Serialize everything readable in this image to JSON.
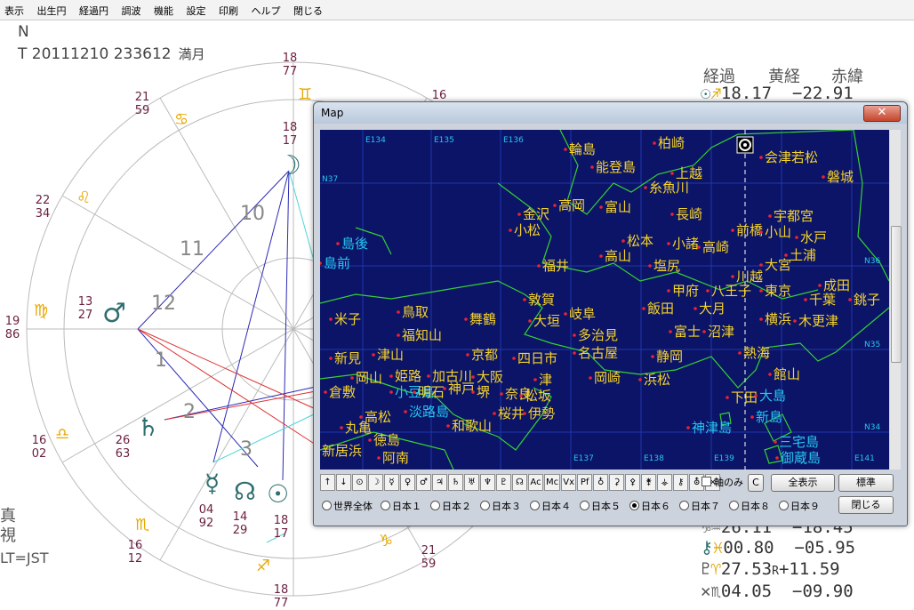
{
  "menu": [
    "表示",
    "出生円",
    "経過円",
    "調波",
    "機能",
    "設定",
    "印刷",
    "ヘルプ",
    "閉じる"
  ],
  "header": {
    "n": "N",
    "t": "T 20111210 233612",
    "moon": "満月"
  },
  "right_header": {
    "keika": "経過",
    "kokei": "黄経",
    "sekii": "赤緯"
  },
  "planets_top": {
    "value": "18.17",
    "dec": "−22.91"
  },
  "planets_bottom": [
    {
      "name": "chiron",
      "sign_icon": "pisces-icon",
      "value": "00.80",
      "dec": "−05.95"
    },
    {
      "name": "pluto",
      "sign_icon": "aries-icon",
      "value": "27.53",
      "retro": "R",
      "dec": "+11.59"
    },
    {
      "name": "node",
      "sign_icon": "scorpio-icon",
      "value": "04.05",
      "dec": "−09.90"
    }
  ],
  "partial_row": {
    "value": "26.11",
    "dec": "−18.45"
  },
  "bottom_left": {
    "shin": "真",
    "shi": "視",
    "lt": "LT=JST"
  },
  "chart_numbers": {
    "n18_77_top": "18",
    "n18_77_top_b": "77",
    "n21_59": "21",
    "n21_59_b": "59",
    "n22_34": "22",
    "n22_34_b": "34",
    "n13_27": "13",
    "n13_27_b": "27",
    "n19_86": "19",
    "n19_86_b": "86",
    "n16_02": "16",
    "n16_02_b": "02",
    "n26_63": "26",
    "n26_63_b": "63",
    "n04_92": "04",
    "n04_92_b": "92",
    "n14_29": "14",
    "n14_29_b": "29",
    "n18_17b": "18",
    "n18_17b_b": "17",
    "n16_12": "16",
    "n16_12_b": "12",
    "n18_77_bot": "18",
    "n18_77_bot_b": "77",
    "n21_59r": "21",
    "n21_59r_b": "59",
    "n18_17_top": "18",
    "n18_17_top_b": "17",
    "n16_partial": "16"
  },
  "houses": {
    "h10": "10",
    "h11": "11",
    "h12": "12",
    "h1": "1",
    "h2": "2",
    "h3": "3"
  },
  "map": {
    "title": "Map",
    "close": "✕",
    "lon_labels": [
      "E134",
      "E135",
      "E136",
      "E137",
      "E138",
      "E139",
      "E141"
    ],
    "lat_labels": [
      "N37",
      "N36",
      "N35",
      "N34"
    ],
    "cities": [
      {
        "name": "輪島"
      },
      {
        "name": "柏崎"
      },
      {
        "name": "会津若松"
      },
      {
        "name": "能登島"
      },
      {
        "name": "上越"
      },
      {
        "name": "磐城"
      },
      {
        "name": "糸魚川"
      },
      {
        "name": "高岡"
      },
      {
        "name": "富山"
      },
      {
        "name": "金沢"
      },
      {
        "name": "長崎"
      },
      {
        "name": "宇都宮"
      },
      {
        "name": "小松"
      },
      {
        "name": "前橋"
      },
      {
        "name": "小山"
      },
      {
        "name": "水戸"
      },
      {
        "name": "松本"
      },
      {
        "name": "小諸"
      },
      {
        "name": "高崎"
      },
      {
        "name": "土浦"
      },
      {
        "name": "島後",
        "c": true
      },
      {
        "name": "高山"
      },
      {
        "name": "島前",
        "c": true
      },
      {
        "name": "福井"
      },
      {
        "name": "塩尻"
      },
      {
        "name": "大宮"
      },
      {
        "name": "川越"
      },
      {
        "name": "成田"
      },
      {
        "name": "敦賀"
      },
      {
        "name": "甲府"
      },
      {
        "name": "八王子"
      },
      {
        "name": "東京"
      },
      {
        "name": "千葉"
      },
      {
        "name": "銚子"
      },
      {
        "name": "鳥取"
      },
      {
        "name": "大垣"
      },
      {
        "name": "岐阜"
      },
      {
        "name": "飯田"
      },
      {
        "name": "大月"
      },
      {
        "name": "横浜"
      },
      {
        "name": "木更津"
      },
      {
        "name": "米子"
      },
      {
        "name": "舞鶴"
      },
      {
        "name": "福知山"
      },
      {
        "name": "多治見"
      },
      {
        "name": "富士"
      },
      {
        "name": "沼津"
      },
      {
        "name": "名古屋"
      },
      {
        "name": "新見"
      },
      {
        "name": "津山"
      },
      {
        "name": "京都"
      },
      {
        "name": "四日市"
      },
      {
        "name": "熱海"
      },
      {
        "name": "姫路"
      },
      {
        "name": "加古川"
      },
      {
        "name": "大阪"
      },
      {
        "name": "岡崎"
      },
      {
        "name": "静岡"
      },
      {
        "name": "館山"
      },
      {
        "name": "岡山"
      },
      {
        "name": "小豆島",
        "c": true
      },
      {
        "name": "津"
      },
      {
        "name": "浜松"
      },
      {
        "name": "倉敷"
      },
      {
        "name": "明石"
      },
      {
        "name": "神戸"
      },
      {
        "name": "堺"
      },
      {
        "name": "奈良"
      },
      {
        "name": "松坂"
      },
      {
        "name": "下田"
      },
      {
        "name": "大島",
        "c": true
      },
      {
        "name": "淡路島",
        "c": true
      },
      {
        "name": "桜井"
      },
      {
        "name": "伊勢"
      },
      {
        "name": "新島",
        "c": true
      },
      {
        "name": "丸亀"
      },
      {
        "name": "高松"
      },
      {
        "name": "和歌山"
      },
      {
        "name": "神津島",
        "c": true
      },
      {
        "name": "徳島"
      },
      {
        "name": "三宅島",
        "c": true
      },
      {
        "name": "新居浜"
      },
      {
        "name": "阿南"
      },
      {
        "name": "御蔵島",
        "c": true
      }
    ],
    "toolbar": [
      "↑",
      "↓",
      "⊙",
      "☽",
      "☿",
      "♀",
      "♂",
      "♃",
      "♄",
      "♅",
      "♆",
      "♇",
      "☊",
      "Ac",
      "Mc",
      "Vx",
      "Pf",
      "♁",
      "⚳",
      "⚴",
      "⚵",
      "⚶",
      "⚷",
      "⛢",
      "×"
    ],
    "axis_only": "軸のみ",
    "c_label": "C",
    "show_all": "全表示",
    "standard": "標準",
    "regions": [
      "世界全体",
      "日本１",
      "日本２",
      "日本３",
      "日本４",
      "日本５",
      "日本６",
      "日本７",
      "日本８",
      "日本９"
    ],
    "selected_region": "日本６",
    "close_btn": "閉じる"
  }
}
